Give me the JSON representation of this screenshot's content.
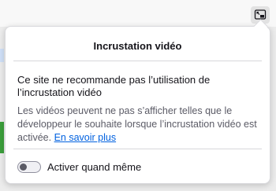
{
  "panel": {
    "title": "Incrustation vidéo",
    "heading": "Ce site ne recommande pas l’utilisation de l’incrustation vidéo",
    "body": "Les vidéos peuvent ne pas s’afficher telles que le développeur le souhaite lorsque l’incrustation vidéo est activée.",
    "learn_more": "En savoir plus",
    "toggle": {
      "label": "Activer quand même",
      "on": false
    }
  },
  "toolbar": {
    "icon": "picture-in-picture-icon"
  },
  "colors": {
    "link": "#0061e0",
    "secondary_text": "#5b5b66",
    "accent_green": "#3b9f3b"
  }
}
